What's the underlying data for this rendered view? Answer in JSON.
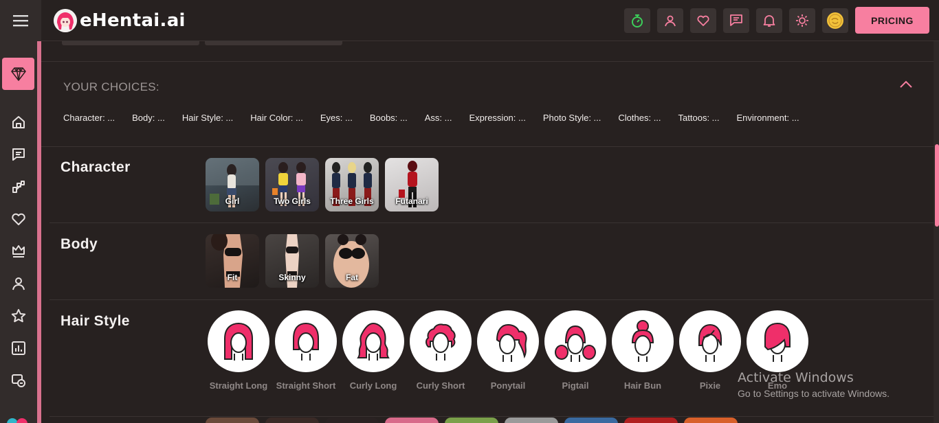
{
  "app": {
    "title": "eHentai.ai"
  },
  "header": {
    "pricing_label": "PRICING"
  },
  "choices": {
    "title": "YOUR CHOICES:",
    "items": [
      "Character: ...",
      "Body: ...",
      "Hair Style: ...",
      "Hair Color: ...",
      "Eyes: ...",
      "Boobs: ...",
      "Ass: ...",
      "Expression: ...",
      "Photo Style: ...",
      "Clothes: ...",
      "Tattoos: ...",
      "Environment: ..."
    ]
  },
  "sections": {
    "character": {
      "title": "Character",
      "options": [
        "Girl",
        "Two Girls",
        "Three Girls",
        "Futanari"
      ]
    },
    "body": {
      "title": "Body",
      "options": [
        "Fit",
        "Skinny",
        "Fat"
      ]
    },
    "hair_style": {
      "title": "Hair Style",
      "options": [
        "Straight Long",
        "Straight Short",
        "Curly Long",
        "Curly Short",
        "Ponytail",
        "Pigtail",
        "Hair Bun",
        "Pixie",
        "Emo"
      ]
    }
  },
  "watermark": {
    "line1": "Activate Windows",
    "line2": "Go to Settings to activate Windows."
  },
  "icons": {
    "sidebar": [
      "menu-icon",
      "diamond-icon",
      "home-icon",
      "chat-icon",
      "puzzle-icon",
      "heart-icon",
      "crown-icon",
      "user-icon",
      "star-icon",
      "chart-icon",
      "gallery-icon"
    ],
    "header": [
      "stopwatch-icon",
      "user-icon",
      "heart-icon",
      "chat-icon",
      "bell-icon",
      "sun-icon",
      "coin-icon"
    ]
  },
  "colors": {
    "accent": "#f77fa0",
    "background": "#272120",
    "sidebar": "#322c2b",
    "hair": "#ef2f6a"
  }
}
